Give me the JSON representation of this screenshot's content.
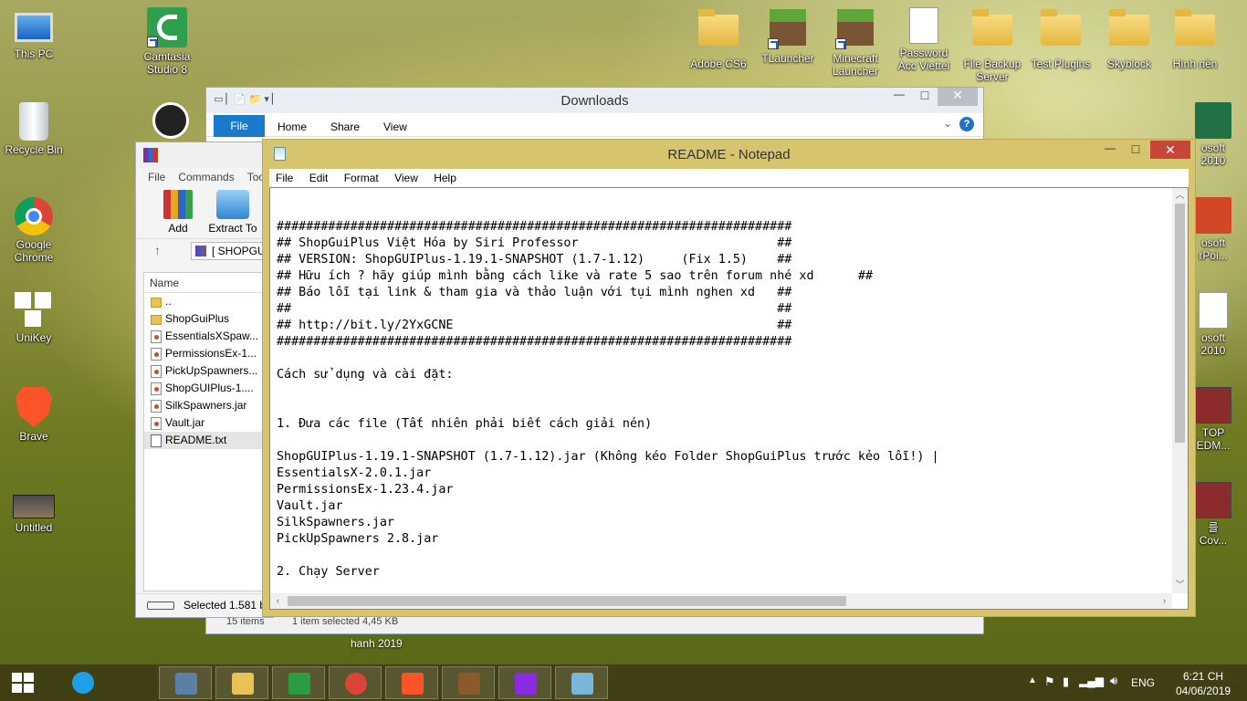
{
  "desktop_left": [
    {
      "label": "This PC",
      "icon": "computer-icon"
    },
    {
      "label": "Recycle Bin",
      "icon": "recycle-bin-icon"
    },
    {
      "label": "Google Chrome",
      "icon": "chrome-icon"
    },
    {
      "label": "UniKey",
      "icon": "unikey-icon"
    },
    {
      "label": "Brave",
      "icon": "brave-icon"
    },
    {
      "label": "Untitled",
      "icon": "video-thumbnail-icon"
    }
  ],
  "desktop_col2": [
    {
      "label": "Camtasia Studio 8",
      "icon": "camtasia-icon"
    }
  ],
  "desktop_top": [
    {
      "label": "Adobe CS6",
      "icon": "folder-icon"
    },
    {
      "label": "TLauncher",
      "icon": "minecraft-grass-icon"
    },
    {
      "label": "Minecraft Launcher",
      "icon": "minecraft-grass-icon"
    },
    {
      "label": "Password Acc Viettel",
      "icon": "text-file-icon"
    },
    {
      "label": "File Backup Server",
      "icon": "folder-icon"
    },
    {
      "label": "Test Plugins",
      "icon": "folder-icon"
    },
    {
      "label": "Skyblock",
      "icon": "folder-icon"
    },
    {
      "label": "Hình nền",
      "icon": "folder-icon"
    }
  ],
  "desktop_right_partial": [
    {
      "label": "osoft\n2010",
      "icon": "excel-icon"
    },
    {
      "label": "osoft\nrPoi...",
      "icon": "powerpoint-icon"
    },
    {
      "label": "osoft\n2010",
      "icon": "word-file-icon"
    },
    {
      "label": "TOP\nEDM...",
      "icon": "video-icon"
    },
    {
      "label": "를\nCov...",
      "icon": "video-icon"
    }
  ],
  "explorer": {
    "title": "Downloads",
    "tabs": [
      "File",
      "Home",
      "Share",
      "View"
    ],
    "status_left": "15 items",
    "status_mid": "1 item selected  4,45 KB",
    "behind_label": "hanh 2019"
  },
  "winrar": {
    "menu": [
      "File",
      "Commands",
      "Too"
    ],
    "toolbar": [
      "Add",
      "Extract To"
    ],
    "path": "[ SHOPGU",
    "column": "Name",
    "files": [
      {
        "name": "..",
        "type": "up"
      },
      {
        "name": "ShopGuiPlus",
        "type": "folder"
      },
      {
        "name": "EssentialsXSpaw...",
        "type": "jar"
      },
      {
        "name": "PermissionsEx-1...",
        "type": "jar"
      },
      {
        "name": "PickUpSpawners...",
        "type": "jar"
      },
      {
        "name": "ShopGUIPlus-1....",
        "type": "jar"
      },
      {
        "name": "SilkSpawners.jar",
        "type": "jar"
      },
      {
        "name": "Vault.jar",
        "type": "jar"
      },
      {
        "name": "README.txt",
        "type": "txt"
      }
    ],
    "status": "Selected 1.581 by"
  },
  "notepad": {
    "title": "README - Notepad",
    "menu": [
      "File",
      "Edit",
      "Format",
      "View",
      "Help"
    ],
    "lines": [
      "",
      "######################################################################",
      "## ShopGuiPlus Việt Hóa by Siri Professor                           ##",
      "## VERSION: ShopGUIPlus-1.19.1-SNAPSHOT (1.7-1.12)     (Fix 1.5)    ##",
      "## Hữu ích ? hãy giúp mình bằng cách like và rate 5 sao trên forum nhé xd      ##",
      "## Báo lỗi tại link & tham gia và thảo luận với tụi mình nghen xd   ##",
      "##                                                                  ##",
      "## http://bit.ly/2YxGCNE                                            ##",
      "######################################################################",
      "",
      "Cách sử dụng và cài đặt:",
      "",
      "",
      "1. Đưa các file (Tất nhiên phải biết cách giải nén)",
      "",
      "ShopGUIPlus-1.19.1-SNAPSHOT (1.7-1.12).jar (Không kéo Folder ShopGuiPlus trước kẻo lỗi!) |",
      "EssentialsX-2.0.1.jar",
      "PermissionsEx-1.23.4.jar",
      "Vault.jar",
      "SilkSpawners.jar",
      "PickUpSpawners 2.8.jar",
      "",
      "2. Chạy Server"
    ]
  },
  "taskbar": {
    "apps": [
      "internet-explorer-icon",
      "remote-desktop-icon",
      "file-explorer-icon",
      "store-icon",
      "chrome-icon",
      "brave-icon",
      "minecraft-crafting-icon",
      "winrar-icon",
      "notepad-icon"
    ],
    "lang": "ENG",
    "time": "6:21 CH",
    "date": "04/06/2019"
  },
  "colors": {
    "notepad_frame": "#d7c46f",
    "close_red": "#c7463a",
    "explorer_file_tab": "#1979ca"
  }
}
